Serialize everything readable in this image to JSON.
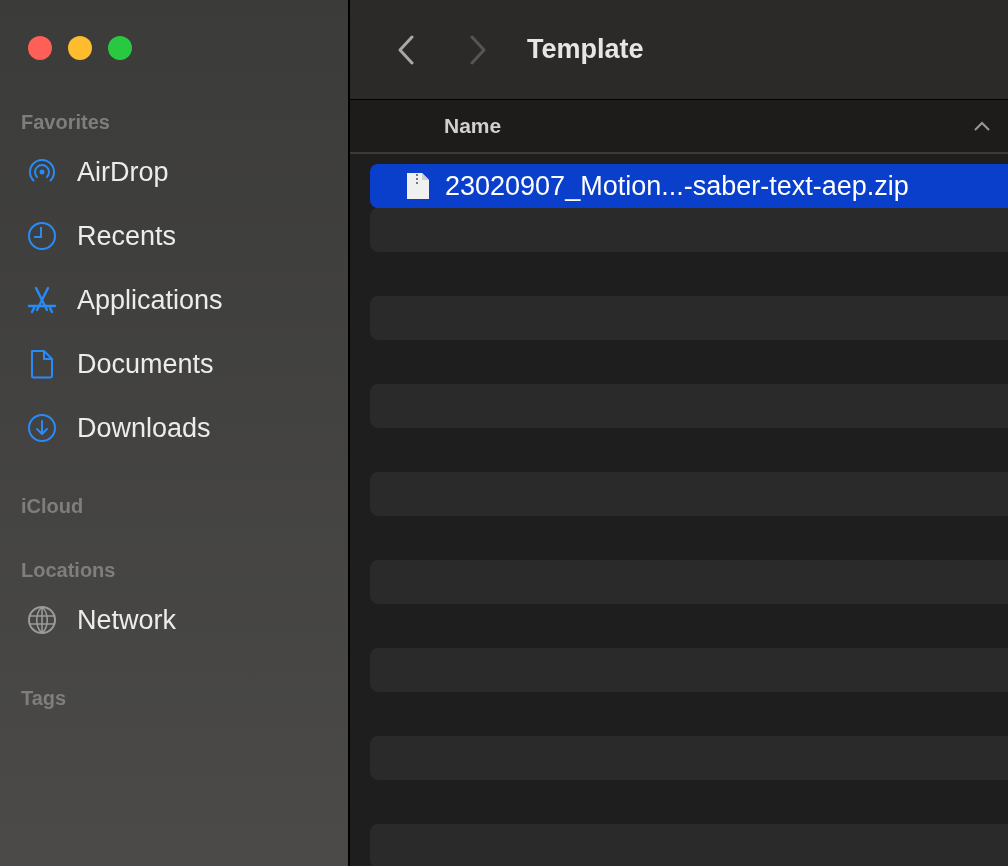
{
  "window": {
    "title": "Template"
  },
  "sidebar": {
    "sections": [
      {
        "heading": "Favorites",
        "items": [
          {
            "label": "AirDrop",
            "kind": "airdrop"
          },
          {
            "label": "Recents",
            "kind": "clock"
          },
          {
            "label": "Applications",
            "kind": "apps"
          },
          {
            "label": "Documents",
            "kind": "document"
          },
          {
            "label": "Downloads",
            "kind": "download"
          }
        ]
      },
      {
        "heading": "iCloud"
      },
      {
        "heading": "Locations",
        "items": [
          {
            "label": "Network",
            "kind": "globe"
          }
        ]
      },
      {
        "heading": "Tags"
      }
    ]
  },
  "table": {
    "columns": [
      "Name"
    ],
    "rows": [
      {
        "name": "23020907_Motion...-saber-text-aep.zip",
        "selected": true
      }
    ]
  }
}
